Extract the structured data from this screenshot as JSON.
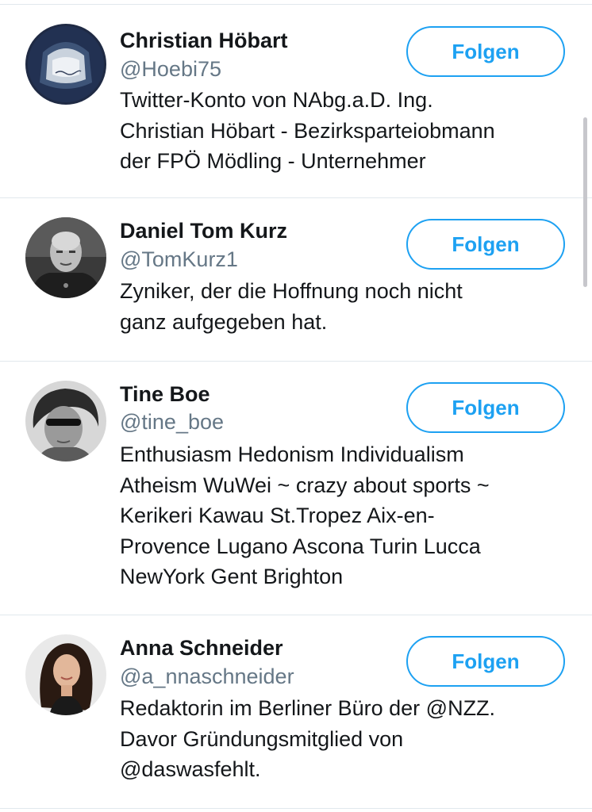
{
  "follow_list": {
    "users": [
      {
        "name": "Christian Höbart",
        "handle": "@Hoebi75",
        "bio_lines": [
          "Twitter-Konto von NAbg.a.D. Ing.",
          "Christian Höbart - Bezirksparteiobmann",
          "der FPÖ Mödling - Unternehmer"
        ],
        "follow_label": "Folgen"
      },
      {
        "name": "Daniel Tom Kurz",
        "handle": "@TomKurz1",
        "bio_lines": [
          "Zyniker, der die Hoffnung noch nicht",
          "ganz aufgegeben hat."
        ],
        "follow_label": "Folgen"
      },
      {
        "name": "Tine Boe",
        "handle": "@tine_boe",
        "bio_lines": [
          "Enthusiasm Hedonism Individualism",
          "Atheism WuWei ~ crazy about sports ~",
          "Kerikeri Kawau St.Tropez Aix-en-",
          "Provence Lugano Ascona Turin Lucca",
          "NewYork Gent Brighton"
        ],
        "follow_label": "Folgen"
      },
      {
        "name": "Anna Schneider",
        "handle": "@a_nnaschneider",
        "bio_lines": [
          "Redaktorin im Berliner Büro der @NZZ.",
          "Davor Gründungsmitglied von",
          "@daswasfehlt."
        ],
        "follow_label": "Folgen"
      }
    ]
  },
  "colors": {
    "accent": "#1da1f2",
    "text": "#14171a",
    "secondary_text": "#657786",
    "divider": "#e1e8ed"
  }
}
